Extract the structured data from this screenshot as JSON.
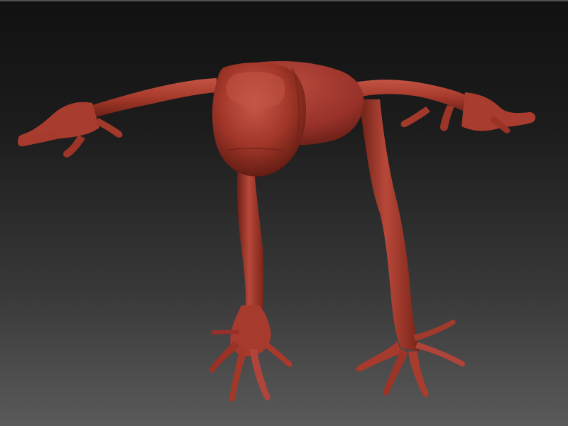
{
  "viewport": {
    "background_top": "#111111",
    "background_bottom": "#5a5a5a"
  },
  "model": {
    "material_color": "#a8382b",
    "shadow_color": "#5e1a12",
    "highlight_color": "#d4614f"
  }
}
